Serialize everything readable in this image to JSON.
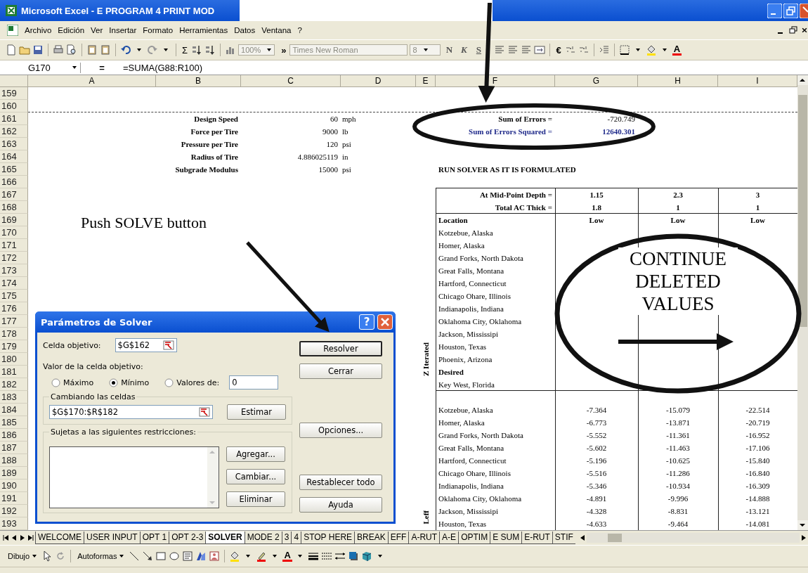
{
  "window": {
    "title": "Microsoft Excel - E PROGRAM 4 PRINT MOD"
  },
  "menu": [
    "Archivo",
    "Edición",
    "Ver",
    "Insertar",
    "Formato",
    "Herramientas",
    "Datos",
    "Ventana",
    "?"
  ],
  "toolbar": {
    "sum": "Σ",
    "zoom": "100%",
    "more": "»",
    "font": "Times New Roman",
    "size": "8",
    "format_buttons": [
      "N",
      "K",
      "S"
    ],
    "currency": "€",
    "font_color": "A"
  },
  "formula_bar": {
    "name_box": "G170",
    "equals": "=",
    "formula": "=SUMA(G88:R100)"
  },
  "columns": [
    "A",
    "B",
    "C",
    "D",
    "E",
    "F",
    "G",
    "H",
    "I"
  ],
  "rows": [
    {
      "number": "159"
    },
    {
      "number": "160",
      "dashed_rule_below": true
    },
    {
      "number": "161",
      "B": {
        "text": "Design Speed",
        "kind": "label"
      },
      "C": {
        "text": "60",
        "kind": "value"
      },
      "D": {
        "text": "mph",
        "kind": "unit"
      },
      "F": {
        "text": "Sum of Errors =",
        "kind": "label"
      },
      "G": {
        "text": "-720.749",
        "kind": "value"
      }
    },
    {
      "number": "162",
      "B": {
        "text": "Force per Tire",
        "kind": "label"
      },
      "C": {
        "text": "9000",
        "kind": "value"
      },
      "D": {
        "text": "lb",
        "kind": "unit"
      },
      "F": {
        "text": "Sum of Errors Squared =",
        "kind": "accent"
      },
      "G": {
        "text": "12640.301",
        "kind": "accent"
      }
    },
    {
      "number": "163",
      "B": {
        "text": "Pressure per Tire",
        "kind": "label"
      },
      "C": {
        "text": "120",
        "kind": "value"
      },
      "D": {
        "text": "psi",
        "kind": "unit"
      }
    },
    {
      "number": "164",
      "B": {
        "text": "Radius of Tire",
        "kind": "label"
      },
      "C": {
        "text": "4.886025119",
        "kind": "value"
      },
      "D": {
        "text": "in",
        "kind": "unit"
      }
    },
    {
      "number": "165",
      "B": {
        "text": "Subgrade Modulus",
        "kind": "label"
      },
      "C": {
        "text": "15000",
        "kind": "value"
      },
      "D": {
        "text": "psi",
        "kind": "unit"
      },
      "F": {
        "text": "RUN SOLVER AS IT IS FORMULATED",
        "kind": "heading"
      }
    },
    {
      "number": "166",
      "rule_below": true
    },
    {
      "number": "167",
      "boxed": true,
      "F": {
        "text": "At Mid-Point Depth =",
        "kind": "label"
      },
      "G": {
        "text": "1.15",
        "kind": "header"
      },
      "H": {
        "text": "2.3",
        "kind": "header"
      },
      "I": {
        "text": "3",
        "kind": "header"
      }
    },
    {
      "number": "168",
      "boxed": true,
      "rule_below": true,
      "F": {
        "text": "Total AC Thick =",
        "kind": "label"
      },
      "G": {
        "text": "1.8",
        "kind": "header"
      },
      "H": {
        "text": "1",
        "kind": "header"
      },
      "I": {
        "text": "1",
        "kind": "header"
      }
    },
    {
      "number": "169",
      "boxed": true,
      "F": {
        "text": "Location",
        "kind": "bold"
      },
      "G": {
        "text": "Low",
        "kind": "header"
      },
      "H": {
        "text": "Low",
        "kind": "header"
      },
      "I": {
        "text": "Low",
        "kind": "header"
      }
    },
    {
      "number": "170",
      "boxed": true,
      "F": {
        "text": "Kotzebue, Alaska",
        "kind": "text"
      }
    },
    {
      "number": "171",
      "boxed": true,
      "F": {
        "text": "Homer, Alaska",
        "kind": "text"
      }
    },
    {
      "number": "172",
      "boxed": true,
      "F": {
        "text": "Grand Forks, North Dakota",
        "kind": "text"
      }
    },
    {
      "number": "173",
      "boxed": true,
      "F": {
        "text": "Great Falls, Montana",
        "kind": "text"
      }
    },
    {
      "number": "174",
      "boxed": true,
      "F": {
        "text": "Hartford, Connecticut",
        "kind": "text"
      }
    },
    {
      "number": "175",
      "boxed": true,
      "F": {
        "text": "Chicago Ohare, Illinois",
        "kind": "text"
      }
    },
    {
      "number": "176",
      "boxed": true,
      "F": {
        "text": "Indianapolis, Indiana",
        "kind": "text"
      }
    },
    {
      "number": "177",
      "boxed": true,
      "F": {
        "text": "Oklahoma City, Oklahoma",
        "kind": "text"
      }
    },
    {
      "number": "178",
      "boxed": true,
      "E": {
        "text": "Z Iterated",
        "kind": "vertical"
      },
      "F": {
        "text": "Jackson, Mississipi",
        "kind": "text"
      }
    },
    {
      "number": "179",
      "boxed": true,
      "F": {
        "text": "Houston, Texas",
        "kind": "text"
      }
    },
    {
      "number": "180",
      "boxed": true,
      "F": {
        "text": "Phoenix, Arizona",
        "kind": "text"
      }
    },
    {
      "number": "181",
      "boxed": true,
      "F": {
        "text": "Desired",
        "kind": "bold"
      }
    },
    {
      "number": "182",
      "boxed": true,
      "rule_below": true,
      "F": {
        "text": "Key West, Florida",
        "kind": "text"
      }
    },
    {
      "number": "183",
      "boxed": true
    },
    {
      "number": "184",
      "boxed": true,
      "F": {
        "text": "Kotzebue, Alaska",
        "kind": "text"
      },
      "G": {
        "text": "-7.364",
        "kind": "center"
      },
      "H": {
        "text": "-15.079",
        "kind": "center"
      },
      "I": {
        "text": "-22.514",
        "kind": "center"
      }
    },
    {
      "number": "185",
      "boxed": true,
      "F": {
        "text": "Homer, Alaska",
        "kind": "text"
      },
      "G": {
        "text": "-6.773",
        "kind": "center"
      },
      "H": {
        "text": "-13.871",
        "kind": "center"
      },
      "I": {
        "text": "-20.719",
        "kind": "center"
      }
    },
    {
      "number": "186",
      "boxed": true,
      "F": {
        "text": "Grand Forks, North Dakota",
        "kind": "text"
      },
      "G": {
        "text": "-5.552",
        "kind": "center"
      },
      "H": {
        "text": "-11.361",
        "kind": "center"
      },
      "I": {
        "text": "-16.952",
        "kind": "center"
      }
    },
    {
      "number": "187",
      "boxed": true,
      "F": {
        "text": "Great Falls, Montana",
        "kind": "text"
      },
      "G": {
        "text": "-5.602",
        "kind": "center"
      },
      "H": {
        "text": "-11.463",
        "kind": "center"
      },
      "I": {
        "text": "-17.106",
        "kind": "center"
      }
    },
    {
      "number": "188",
      "boxed": true,
      "F": {
        "text": "Hartford, Connecticut",
        "kind": "text"
      },
      "G": {
        "text": "-5.196",
        "kind": "center"
      },
      "H": {
        "text": "-10.625",
        "kind": "center"
      },
      "I": {
        "text": "-15.840",
        "kind": "center"
      }
    },
    {
      "number": "189",
      "boxed": true,
      "F": {
        "text": "Chicago Ohare, Illinois",
        "kind": "text"
      },
      "G": {
        "text": "-5.516",
        "kind": "center"
      },
      "H": {
        "text": "-11.286",
        "kind": "center"
      },
      "I": {
        "text": "-16.840",
        "kind": "center"
      }
    },
    {
      "number": "190",
      "boxed": true,
      "F": {
        "text": "Indianapolis, Indiana",
        "kind": "text"
      },
      "G": {
        "text": "-5.346",
        "kind": "center"
      },
      "H": {
        "text": "-10.934",
        "kind": "center"
      },
      "I": {
        "text": "-16.309",
        "kind": "center"
      }
    },
    {
      "number": "191",
      "boxed": true,
      "F": {
        "text": "Oklahoma City, Oklahoma",
        "kind": "text"
      },
      "G": {
        "text": "-4.891",
        "kind": "center"
      },
      "H": {
        "text": "-9.996",
        "kind": "center"
      },
      "I": {
        "text": "-14.888",
        "kind": "center"
      }
    },
    {
      "number": "192",
      "boxed": true,
      "E": {
        "text": "Leff",
        "kind": "vertical"
      },
      "F": {
        "text": "Jackson, Mississipi",
        "kind": "text"
      },
      "G": {
        "text": "-4.328",
        "kind": "center"
      },
      "H": {
        "text": "-8.831",
        "kind": "center"
      },
      "I": {
        "text": "-13.121",
        "kind": "center"
      }
    },
    {
      "number": "193",
      "boxed": true,
      "F": {
        "text": "Houston, Texas",
        "kind": "text"
      },
      "G": {
        "text": "-4.633",
        "kind": "center"
      },
      "H": {
        "text": "-9.464",
        "kind": "center"
      },
      "I": {
        "text": "-14.081",
        "kind": "center"
      }
    }
  ],
  "dialog": {
    "title": "Parámetros de Solver",
    "help": "?",
    "target_label": "Celda objetivo:",
    "target_cell": "$G$162",
    "value_label": "Valor de la celda objetivo:",
    "options": [
      {
        "label": "Máximo",
        "selected": false
      },
      {
        "label": "Mínimo",
        "selected": true
      },
      {
        "label": "Valores de:",
        "selected": false
      }
    ],
    "value": "0",
    "changing_label": "Cambiando las celdas",
    "changing_cells": "$G$170:$R$182",
    "guess_button": "Estimar",
    "constraints_label": "Sujetas a las siguientes restricciones:",
    "constraint_buttons": [
      "Agregar...",
      "Cambiar...",
      "Eliminar"
    ],
    "buttons": [
      {
        "label": "Resolver",
        "default": true
      },
      {
        "label": "Cerrar",
        "default": false
      },
      {
        "label": "Opciones...",
        "default": false
      },
      {
        "label": "Restablecer todo",
        "default": false
      },
      {
        "label": "Ayuda",
        "default": false
      }
    ]
  },
  "sheet_tabs": [
    {
      "label": "WELCOME",
      "selected": false
    },
    {
      "label": "USER INPUT",
      "selected": false
    },
    {
      "label": "OPT 1",
      "selected": false
    },
    {
      "label": "OPT 2-3",
      "selected": false
    },
    {
      "label": "SOLVER",
      "selected": true
    },
    {
      "label": "MODE 2",
      "selected": false
    },
    {
      "label": "3",
      "selected": false
    },
    {
      "label": "4",
      "selected": false
    },
    {
      "label": "STOP HERE",
      "selected": false
    },
    {
      "label": "BREAK",
      "selected": false
    },
    {
      "label": "EFF",
      "selected": false
    },
    {
      "label": "A-RUT",
      "selected": false
    },
    {
      "label": "A-E",
      "selected": false
    },
    {
      "label": "OPTIM",
      "selected": false
    },
    {
      "label": "E SUM",
      "selected": false
    },
    {
      "label": "E-RUT",
      "selected": false
    },
    {
      "label": "STIF",
      "selected": false
    }
  ],
  "drawing_toolbar": {
    "draw_menu": "Dibujo",
    "autoshapes_menu": "Autoformas",
    "font_color": "A"
  },
  "annotations": {
    "instruction": "Push SOLVE button",
    "note": "CONTINUE DELETED VALUES"
  }
}
